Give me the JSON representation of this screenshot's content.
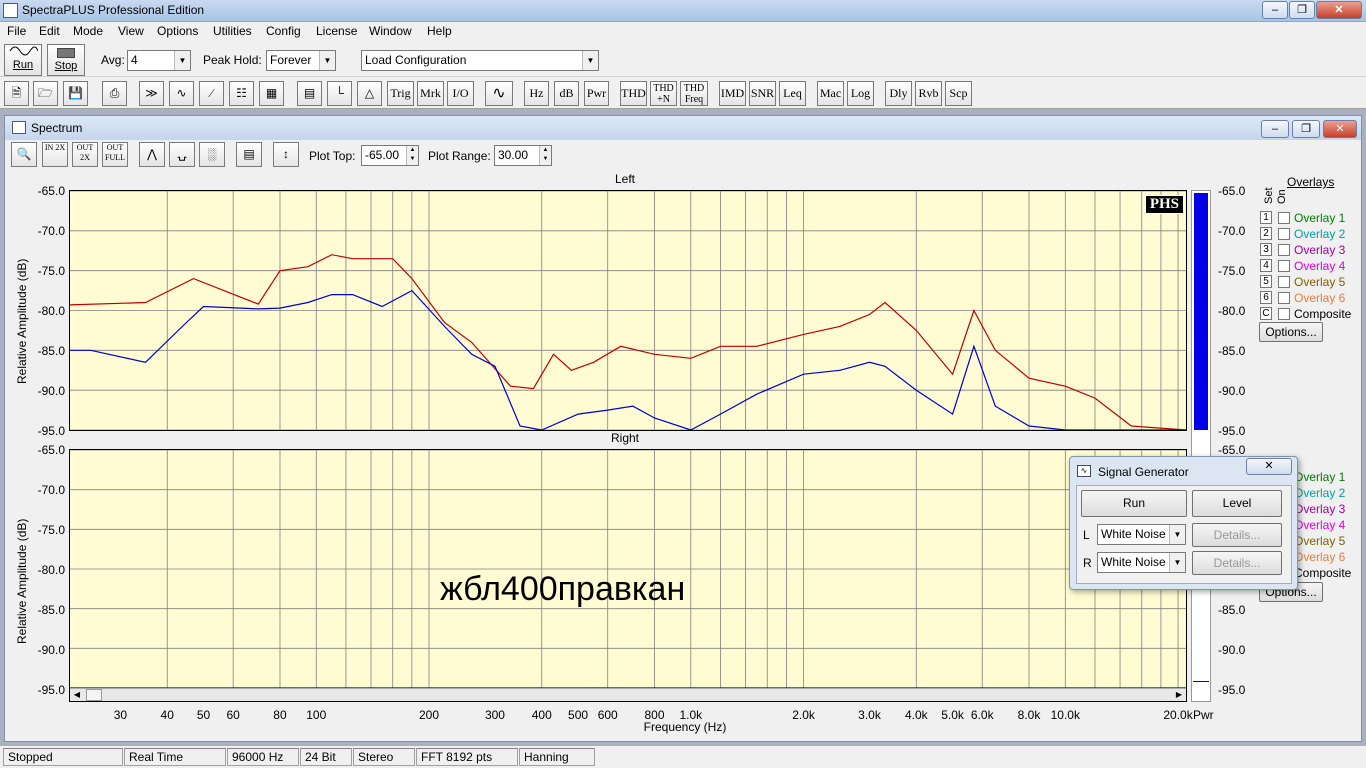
{
  "app": {
    "title": "SpectraPLUS Professional Edition"
  },
  "menu": [
    "File",
    "Edit",
    "Mode",
    "View",
    "Options",
    "Utilities",
    "Config",
    "License",
    "Window",
    "Help"
  ],
  "toolbar1": {
    "run": "Run",
    "stop": "Stop",
    "avg_label": "Avg:",
    "avg_value": "4",
    "peak_label": "Peak Hold:",
    "peak_value": "Forever",
    "config_value": "Load Configuration"
  },
  "toolbar2": {
    "buttons": [
      "Trig",
      "Mrk",
      "I/O",
      "Hz",
      "dB",
      "Pwr",
      "THD",
      "THD +N",
      "THD Freq",
      "IMD",
      "SNR",
      "Leq",
      "Mac",
      "Log",
      "Dly",
      "Rvb",
      "Scp"
    ]
  },
  "spectrum": {
    "title": "Spectrum",
    "plot_top_label": "Plot Top:",
    "plot_top_value": "-65.00",
    "plot_range_label": "Plot Range:",
    "plot_range_value": "30.00",
    "zoom_buttons": [
      "IN 2X",
      "OUT 2X",
      "OUT FULL"
    ],
    "logo": "PHS",
    "overlays_title": "Overlays",
    "set_label": "Set",
    "on_label": "On",
    "overlays": [
      {
        "set": "1",
        "name": "Overlay 1",
        "color": "#008000"
      },
      {
        "set": "2",
        "name": "Overlay 2",
        "color": "#00a0a0"
      },
      {
        "set": "3",
        "name": "Overlay 3",
        "color": "#a000a0"
      },
      {
        "set": "4",
        "name": "Overlay 4",
        "color": "#e000e0"
      },
      {
        "set": "5",
        "name": "Overlay 5",
        "color": "#806000"
      },
      {
        "set": "6",
        "name": "Overlay 6",
        "color": "#e08040"
      },
      {
        "set": "C",
        "name": "Composite",
        "color": "#000000"
      }
    ],
    "options_label": "Options...",
    "pwr_label": "Pwr",
    "annotation": "жбл400правкан"
  },
  "chart_data": [
    {
      "type": "line",
      "title": "Left",
      "xlabel": "Frequency (Hz)",
      "ylabel": "Relative Amplitude (dB)",
      "xscale": "log",
      "xlim": [
        22,
        21000
      ],
      "ylim": [
        -95,
        -65
      ],
      "y_ticks": [
        "-65.0",
        "-70.0",
        "-75.0",
        "-80.0",
        "-85.0",
        "-90.0",
        "-95.0"
      ],
      "x_ticks": [
        "30",
        "40",
        "50",
        "60",
        "80",
        "100",
        "200",
        "300",
        "400",
        "500",
        "600",
        "800",
        "1.0k",
        "2.0k",
        "3.0k",
        "4.0k",
        "5.0k",
        "6.0k",
        "8.0k",
        "10.0k",
        "20.0k"
      ],
      "series": [
        {
          "color": "#c00000",
          "x": [
            22,
            35,
            47,
            70,
            80,
            95,
            110,
            125,
            160,
            180,
            220,
            260,
            330,
            380,
            430,
            480,
            550,
            650,
            800,
            1000,
            1200,
            1500,
            2000,
            2500,
            3000,
            3300,
            4000,
            5000,
            5700,
            6500,
            8000,
            10000,
            12000,
            15000,
            21000
          ],
          "y": [
            -79.3,
            -79,
            -76,
            -79.2,
            -75,
            -74.5,
            -73,
            -73.5,
            -73.5,
            -76,
            -81.5,
            -84,
            -89.5,
            -89.8,
            -85.5,
            -87.5,
            -86.5,
            -84.5,
            -85.5,
            -86,
            -84.5,
            -84.5,
            -83,
            -82,
            -80.5,
            -79,
            -82.5,
            -88,
            -80,
            -85,
            -88.5,
            -89.5,
            -91,
            -94.5,
            -95
          ]
        },
        {
          "color": "#0000cc",
          "x": [
            22,
            25,
            35,
            45,
            50,
            70,
            80,
            95,
            110,
            125,
            150,
            180,
            220,
            260,
            300,
            350,
            400,
            500,
            600,
            700,
            800,
            1000,
            1200,
            1500,
            2000,
            2500,
            3000,
            3300,
            4000,
            5000,
            5700,
            6500,
            8000,
            10000,
            21000
          ],
          "y": [
            -85,
            -85,
            -86.5,
            -81.5,
            -79.5,
            -79.8,
            -79.7,
            -79,
            -78,
            -78,
            -79.5,
            -77.5,
            -82,
            -85.5,
            -87,
            -94.5,
            -95,
            -93,
            -92.5,
            -92,
            -93.5,
            -95,
            -93,
            -90.5,
            -88,
            -87.5,
            -86.5,
            -87,
            -90,
            -93,
            -84.5,
            -92,
            -94.5,
            -95,
            -95
          ]
        }
      ]
    },
    {
      "type": "line",
      "title": "Right",
      "xlabel": "Frequency (Hz)",
      "ylabel": "Relative Amplitude (dB)",
      "xscale": "log",
      "xlim": [
        22,
        21000
      ],
      "ylim": [
        -95,
        -65
      ],
      "y_ticks": [
        "-65.0",
        "-70.0",
        "-75.0",
        "-80.0",
        "-85.0",
        "-90.0",
        "-95.0"
      ],
      "x_ticks": [
        "30",
        "40",
        "50",
        "60",
        "80",
        "100",
        "200",
        "300",
        "400",
        "500",
        "600",
        "800",
        "1.0k",
        "2.0k",
        "3.0k",
        "4.0k",
        "5.0k",
        "6.0k",
        "8.0k",
        "10.0k",
        "20.0k"
      ],
      "series": [
        {
          "color": "#0000cc",
          "x": [
            22,
            21000
          ],
          "y": [
            -95,
            -95
          ]
        }
      ]
    }
  ],
  "signal_generator": {
    "title": "Signal Generator",
    "run": "Run",
    "level": "Level",
    "l_label": "L",
    "r_label": "R",
    "l_value": "White Noise",
    "r_value": "White Noise",
    "details": "Details..."
  },
  "status": [
    "Stopped",
    "Real Time",
    "96000 Hz",
    "24 Bit",
    "Stereo",
    "FFT 8192 pts",
    "Hanning"
  ]
}
